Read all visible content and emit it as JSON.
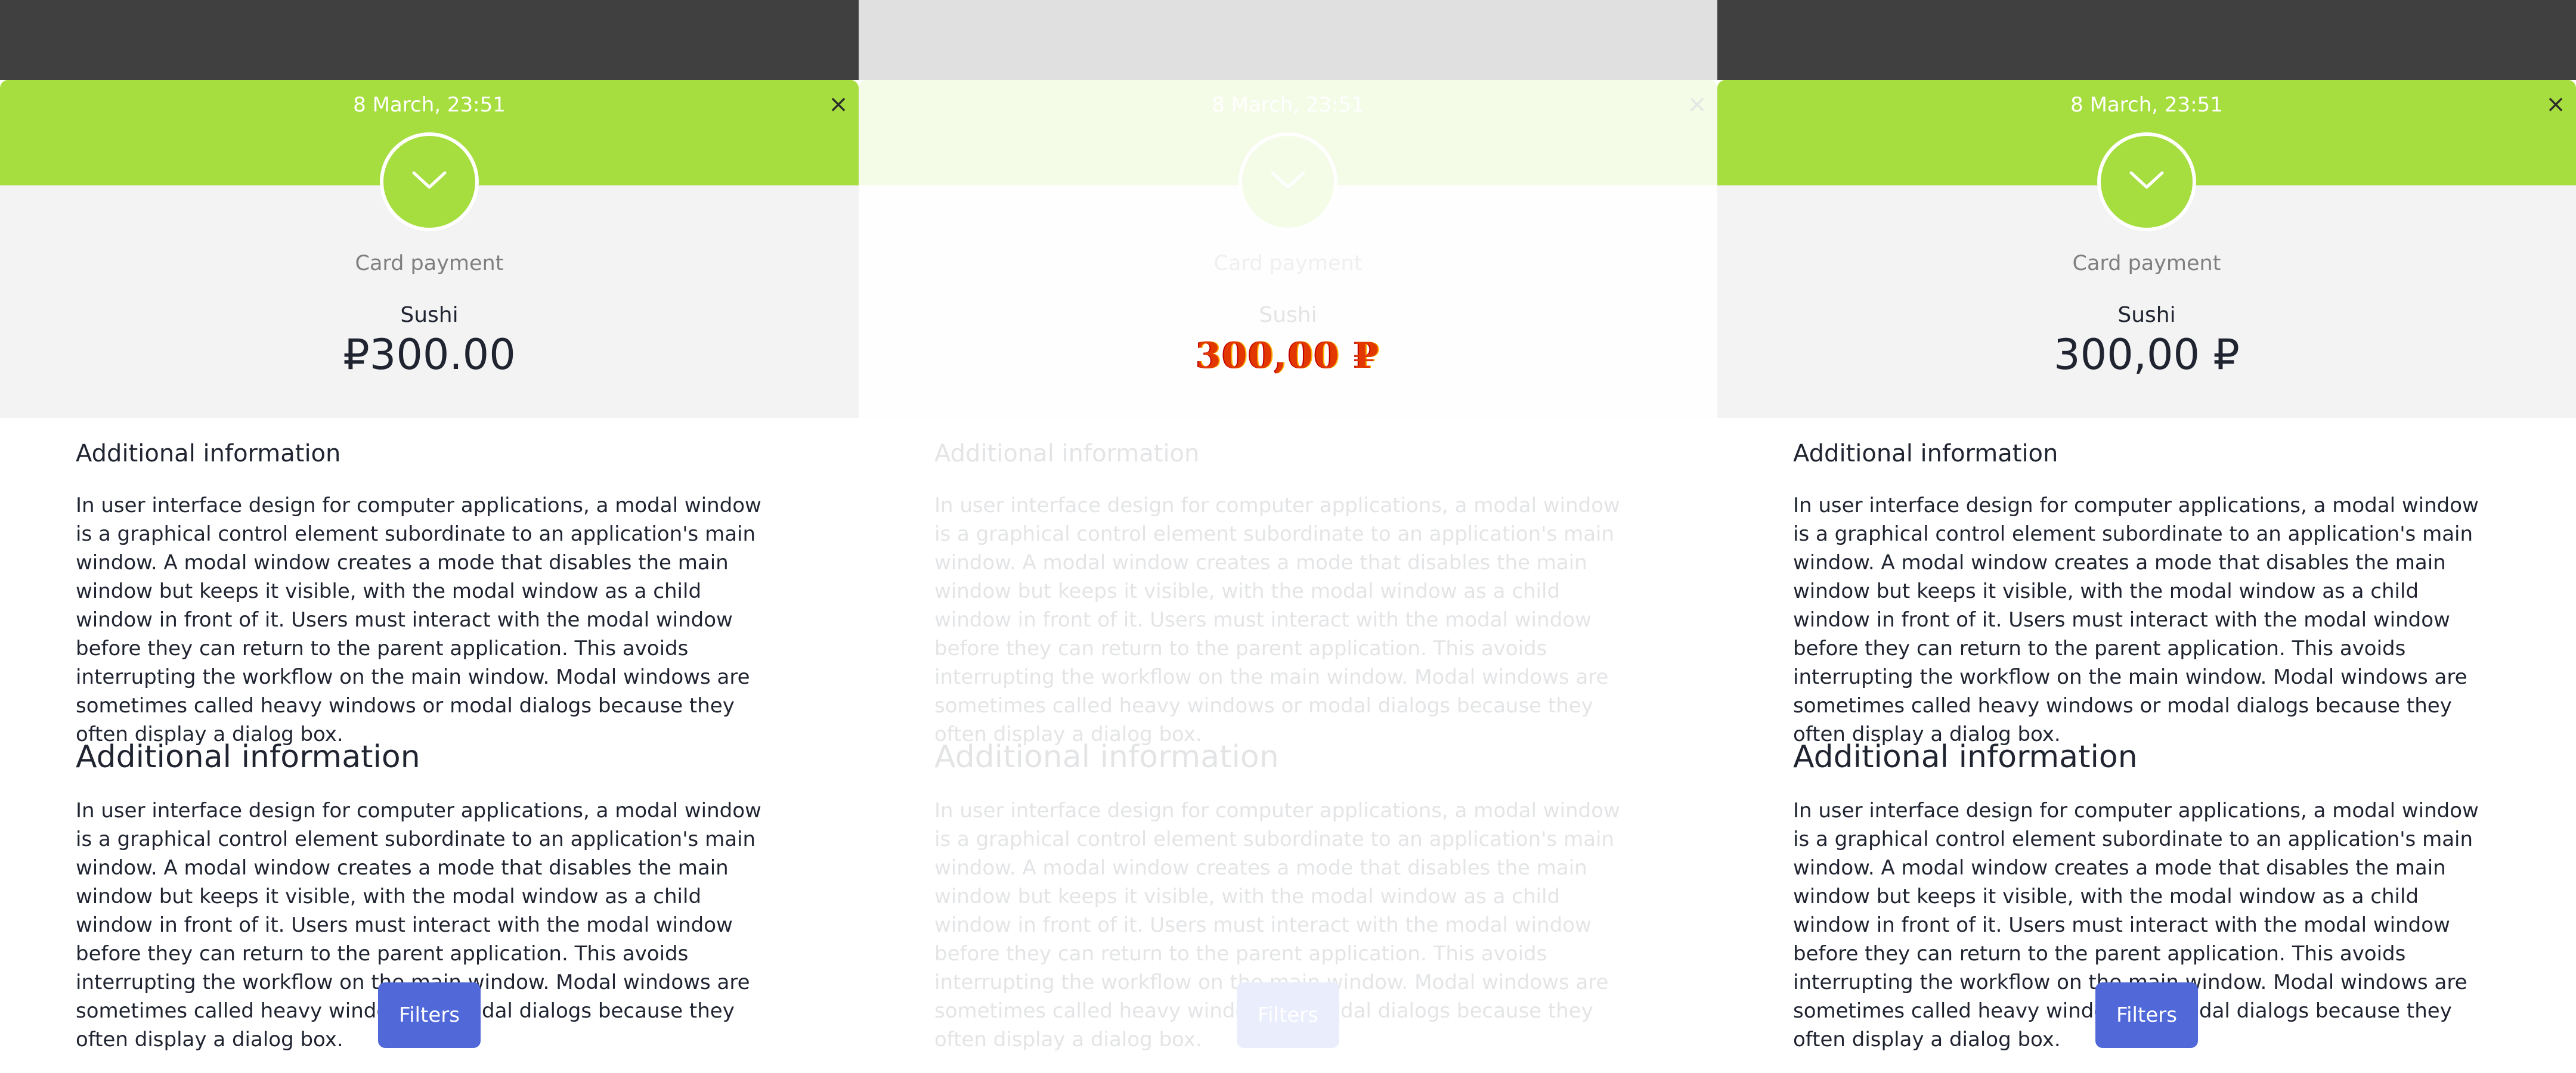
{
  "panels": [
    {
      "state": "normal",
      "datetime": "8 March, 23:51",
      "close_glyph": "×",
      "payment_method": "Card payment",
      "merchant": "Sushi",
      "amount": "₽300.00",
      "section_title_small": "Additional information",
      "paragraph_1": "In user interface design for computer applications, a modal window is a graphical control element subordinate to an application's main window. A modal window creates a mode that disables the main window but keeps it visible, with the modal window as a child window in front of it. Users must interact with the modal window before they can return to the parent application. This avoids interrupting the workflow on the main window. Modal windows are sometimes called heavy windows or modal dialogs because they often display a dialog box.",
      "section_title_large": "Additional information",
      "paragraph_2": "In user interface design for computer applications, a modal window is a graphical control element subordinate to an application's main window. A modal window creates a mode that disables the main window but keeps it visible, with the modal window as a child window in front of it. Users must interact with the modal window before they can return to the parent application. This avoids interrupting the workflow on the main window. Modal windows are sometimes called heavy windows or modal dialogs because they often display a dialog box.",
      "filters_label": "Filters",
      "status_icon": "chevron-down-icon"
    },
    {
      "state": "faded",
      "datetime": "8 March, 23:51",
      "close_glyph": "×",
      "payment_method": "Card payment",
      "merchant": "Sushi",
      "amount": "300,00 ₽",
      "section_title_small": "Additional information",
      "paragraph_1": "In user interface design for computer applications, a modal window is a graphical control element subordinate to an application's main window. A modal window creates a mode that disables the main window but keeps it visible, with the modal window as a child window in front of it. Users must interact with the modal window before they can return to the parent application. This avoids interrupting the workflow on the main window. Modal windows are sometimes called heavy windows or modal dialogs because they often display a dialog box.",
      "section_title_large": "Additional information",
      "paragraph_2": "In user interface design for computer applications, a modal window is a graphical control element subordinate to an application's main window. A modal window creates a mode that disables the main window but keeps it visible, with the modal window as a child window in front of it. Users must interact with the modal window before they can return to the parent application. This avoids interrupting the workflow on the main window. Modal windows are sometimes called heavy windows or modal dialogs because they often display a dialog box.",
      "filters_label": "Filters",
      "status_icon": "chevron-down-icon"
    },
    {
      "state": "normal",
      "datetime": "8 March, 23:51",
      "close_glyph": "×",
      "payment_method": "Card payment",
      "merchant": "Sushi",
      "amount": "300,00 ₽",
      "section_title_small": "Additional information",
      "paragraph_1": "In user interface design for computer applications, a modal window is a graphical control element subordinate to an application's main window. A modal window creates a mode that disables the main window but keeps it visible, with the modal window as a child window in front of it. Users must interact with the modal window before they can return to the parent application. This avoids interrupting the workflow on the main window. Modal windows are sometimes called heavy windows or modal dialogs because they often display a dialog box.",
      "section_title_large": "Additional information",
      "paragraph_2": "In user interface design for computer applications, a modal window is a graphical control element subordinate to an application's main window. A modal window creates a mode that disables the main window but keeps it visible, with the modal window as a child window in front of it. Users must interact with the modal window before they can return to the parent application. This avoids interrupting the workflow on the main window. Modal windows are sometimes called heavy windows or modal dialogs because they often display a dialog box.",
      "filters_label": "Filters",
      "status_icon": "chevron-down-icon"
    }
  ],
  "colors": {
    "header_green": "#a6dd3f",
    "backdrop_dark": "#404040",
    "summary_gray": "#f3f3f3",
    "button_blue": "#5068d8",
    "text_dark": "#1f2430",
    "text_muted": "#7f7f7f",
    "glitch_amount": "#e23800"
  }
}
